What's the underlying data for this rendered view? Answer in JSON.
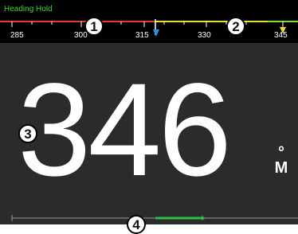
{
  "mode": {
    "label": "Heading Hold"
  },
  "compass": {
    "tick_labels": [
      "285",
      "300",
      "315",
      "330",
      "345"
    ],
    "current_heading_marker": "blue-triangle",
    "target_marker": "yellow-indicator",
    "colors": {
      "port": "#e23b2e",
      "starboard": "#7ddc3c",
      "target_zone": "#e8e02a",
      "marker": "#2f8fe0"
    }
  },
  "heading": {
    "value": "346",
    "degree_symbol": "°",
    "reference": "M"
  },
  "rudder": {
    "colors": {
      "line": "#9a9a9a",
      "active": "#2ec04a"
    }
  },
  "callouts": [
    "1",
    "2",
    "3",
    "4"
  ]
}
